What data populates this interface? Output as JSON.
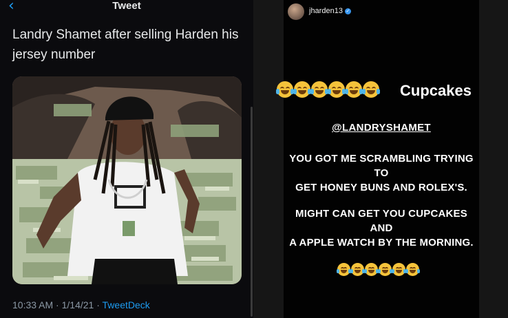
{
  "tweet": {
    "header_title": "Tweet",
    "text": "Landry Shamet after selling Harden his jersey number",
    "time": "10:33 AM",
    "date": "1/14/21",
    "source": "TweetDeck",
    "separator": "·"
  },
  "story": {
    "username": "jharden13",
    "verified_mark": "✓",
    "headline": "Cupcakes",
    "mention": "@LANDRYSHAMET",
    "line1": "YOU GOT ME SCRAMBLING TRYING TO",
    "line2": "GET HONEY BUNS AND ROLEX'S.",
    "line3": "MIGHT CAN GET YOU CUPCAKES AND",
    "line4": "A APPLE WATCH BY THE MORNING."
  },
  "icons": {
    "back": "chevron-left-icon",
    "verified": "verified-badge-icon"
  },
  "colors": {
    "link": "#1d9bf0",
    "background": "#000000",
    "text": "#e7e9ea"
  }
}
